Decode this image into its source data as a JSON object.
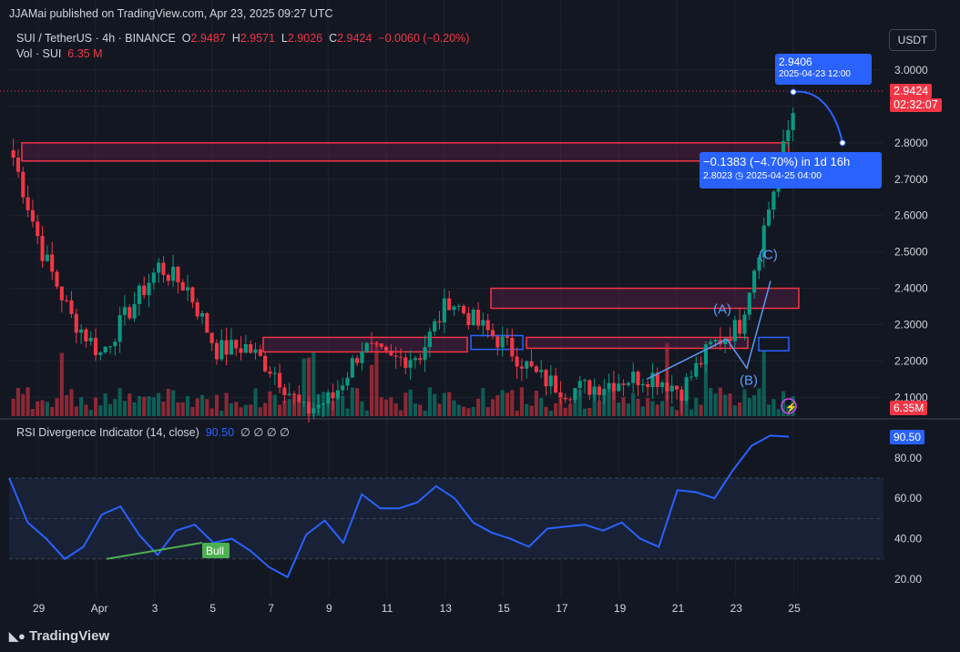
{
  "publisher_line": "JJAMai published on TradingView.com, Apr 23, 2025 09:27 UTC",
  "header": {
    "symbol": "SUI / TetherUS · 4h · BINANCE",
    "o_label": "O",
    "o_value": "2.9487",
    "h_label": "H",
    "h_value": "2.9571",
    "l_label": "L",
    "l_value": "2.9026",
    "c_label": "C",
    "c_value": "2.9424",
    "change": "−0.0060 (−0.20%)",
    "vol_label": "Vol · SUI",
    "vol_value": "6.35 M"
  },
  "currency_button": "USDT",
  "price_tags": {
    "last_price": "2.9424",
    "countdown": "02:32:07",
    "volume": "6.35M"
  },
  "projection": {
    "start_price": "2.9406",
    "start_time": "2025-04-23 12:00",
    "change_text": "−0.1383 (−4.70%) in 1d 16h",
    "end_price": "2.8023",
    "end_time": "2025-04-25  04:00"
  },
  "annotations": {
    "wave_a": "(A)",
    "wave_b": "(B)",
    "wave_c": "(C)",
    "bull": "Bull"
  },
  "rsi": {
    "title": "RSI Divergence Indicator (14, close)",
    "value": "90.50",
    "value_tag": "90.50",
    "flags": "∅ ∅ ∅ ∅"
  },
  "branding": "TradingView",
  "colors": {
    "bull": "#089981",
    "bear": "#f23645",
    "rsi": "#2962ff",
    "zone_border": "#f23645",
    "zone_fill": "#5c1f4a",
    "blue_box": "#2962ff",
    "bg": "#131722"
  },
  "chart_data": [
    {
      "type": "candlestick",
      "title": "SUI / TetherUS · 4h · BINANCE",
      "x_ticks": [
        "29",
        "Apr",
        "3",
        "5",
        "7",
        "9",
        "11",
        "13",
        "15",
        "17",
        "19",
        "21",
        "23",
        "25"
      ],
      "y_ticks": [
        "3.0000",
        "2.9000",
        "2.8000",
        "2.7000",
        "2.6000",
        "2.5000",
        "2.4000",
        "2.3000",
        "2.2000",
        "2.1000"
      ],
      "ylim": [
        2.065,
        3.03
      ],
      "approx_close_path": [
        {
          "x": "Mar 28",
          "y": 2.76
        },
        {
          "x": "Mar 29",
          "y": 2.5
        },
        {
          "x": "Mar 30",
          "y": 2.32
        },
        {
          "x": "Mar 31",
          "y": 2.22
        },
        {
          "x": "Apr 1",
          "y": 2.34
        },
        {
          "x": "Apr 2",
          "y": 2.46
        },
        {
          "x": "Apr 3",
          "y": 2.4
        },
        {
          "x": "Apr 4",
          "y": 2.23
        },
        {
          "x": "Apr 5",
          "y": 2.24
        },
        {
          "x": "Apr 6",
          "y": 2.17
        },
        {
          "x": "Apr 7",
          "y": 2.06
        },
        {
          "x": "Apr 8",
          "y": 2.1
        },
        {
          "x": "Apr 9",
          "y": 2.24
        },
        {
          "x": "Apr 10",
          "y": 2.2
        },
        {
          "x": "Apr 11",
          "y": 2.22
        },
        {
          "x": "Apr 12",
          "y": 2.37
        },
        {
          "x": "Apr 13",
          "y": 2.3
        },
        {
          "x": "Apr 14",
          "y": 2.24
        },
        {
          "x": "Apr 15",
          "y": 2.16
        },
        {
          "x": "Apr 16",
          "y": 2.12
        },
        {
          "x": "Apr 17",
          "y": 2.13
        },
        {
          "x": "Apr 18",
          "y": 2.15
        },
        {
          "x": "Apr 19",
          "y": 2.16
        },
        {
          "x": "Apr 20",
          "y": 2.12
        },
        {
          "x": "Apr 21",
          "y": 2.24
        },
        {
          "x": "Apr 22",
          "y": 2.3
        },
        {
          "x": "Apr 22 12:00",
          "y": 2.62
        },
        {
          "x": "Apr 23",
          "y": 2.94
        }
      ],
      "last_close": 2.9424,
      "volume_last": "6.35M"
    },
    {
      "type": "line",
      "title": "RSI Divergence Indicator (14, close)",
      "y_ticks": [
        "80.00",
        "60.00",
        "40.00",
        "20.00"
      ],
      "ylim": [
        15,
        96
      ],
      "bands": [
        30,
        50,
        70
      ],
      "series": [
        {
          "name": "",
          "values": [
            70,
            48,
            40,
            30,
            36,
            52,
            56,
            42,
            32,
            44,
            47,
            38,
            40,
            34,
            26,
            21,
            42,
            49,
            38,
            62,
            55,
            55,
            58,
            66,
            60,
            48,
            43,
            40,
            36,
            45,
            46,
            47,
            44,
            48,
            40,
            36,
            64,
            63,
            60,
            74,
            86,
            91,
            90.5
          ]
        }
      ],
      "current": 90.5
    }
  ]
}
